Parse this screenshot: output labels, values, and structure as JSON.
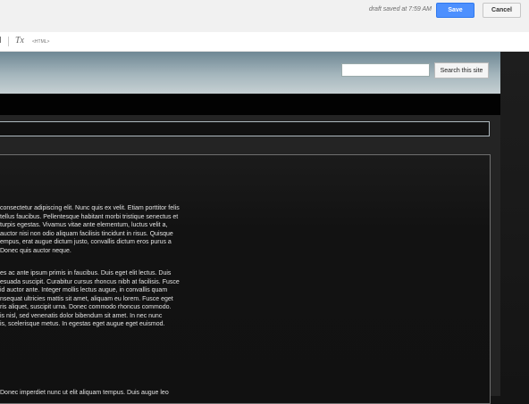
{
  "header": {
    "draft_status": "draft saved at 7:59 AM",
    "save_label": "Save",
    "cancel_label": "Cancel"
  },
  "toolbar": {
    "clear_formatting_label": "Tx",
    "html_label": "<HTML>"
  },
  "site": {
    "search_placeholder": "",
    "search_button_label": "Search this site"
  },
  "content": {
    "paragraphs": [
      [
        "consectetur adipiscing elit. Nunc quis ex velit. Etiam porttitor felis",
        "tellus faucibus. Pellentesque habitant morbi tristique senectus et",
        "turpis egestas. Vivamus vitae ante elementum, luctus velit a,",
        "auctor nisi non odio aliquam facilisis tincidunt in risus. Quisque",
        "empus, erat augue dictum justo, convallis dictum eros purus a",
        "Donec quis auctor neque."
      ],
      [
        "es ac ante ipsum primis in faucibus. Duis eget elit lectus. Duis",
        "esuada suscipit. Curabitur cursus rhoncus nibh at facilisis. Fusce",
        "id auctor ante. Integer mollis lectus augue, in convallis quam",
        "nsequat ultricies mattis sit amet, aliquam eu lorem. Fusce eget",
        "ris aliquet, suscipit urna. Donec commodo rhoncus commodo.",
        "is nisl, sed venenatis dolor bibendum sit amet. In nec nunc",
        "is, scelerisque metus. In egestas eget augue eget euismod."
      ],
      [
        "Donec imperdiet nunc ut elit aliquam tempus. Duis augue leo"
      ]
    ]
  },
  "colors": {
    "save_blue": "#4d90fe",
    "page_background": "#141414"
  }
}
